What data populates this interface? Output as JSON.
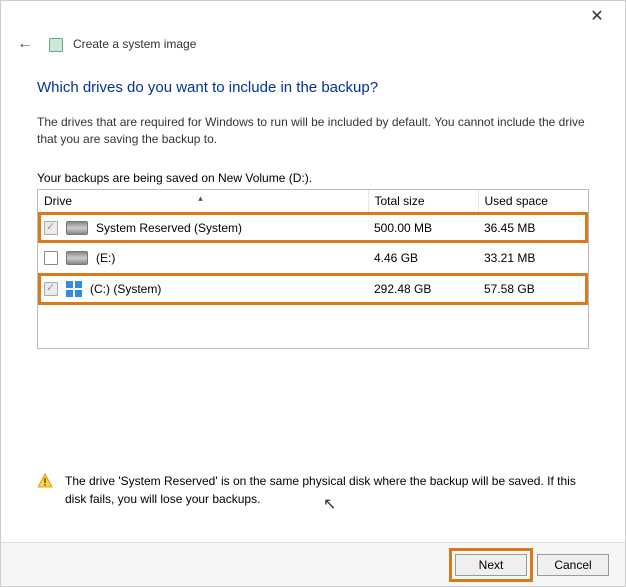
{
  "window": {
    "title": "Create a system image"
  },
  "heading": "Which drives do you want to include in the backup?",
  "description": "The drives that are required for Windows to run will be included by default. You cannot include the drive that you are saving the backup to.",
  "saved_to_label": "Your backups are being saved on New Volume (D:).",
  "columns": {
    "drive": "Drive",
    "total": "Total size",
    "used": "Used space"
  },
  "drives": [
    {
      "name": "System Reserved (System)",
      "total": "500.00 MB",
      "used": "36.45 MB",
      "checked": true,
      "locked": true,
      "icon": "hdd",
      "highlight": true
    },
    {
      "name": "(E:)",
      "total": "4.46 GB",
      "used": "33.21 MB",
      "checked": false,
      "locked": false,
      "icon": "hdd",
      "highlight": false
    },
    {
      "name": "(C:) (System)",
      "total": "292.48 GB",
      "used": "57.58 GB",
      "checked": true,
      "locked": true,
      "icon": "win",
      "highlight": true
    }
  ],
  "warning": "The drive 'System Reserved' is on the same physical disk where the backup will be saved. If this disk fails, you will lose your backups.",
  "buttons": {
    "next": "Next",
    "cancel": "Cancel"
  }
}
